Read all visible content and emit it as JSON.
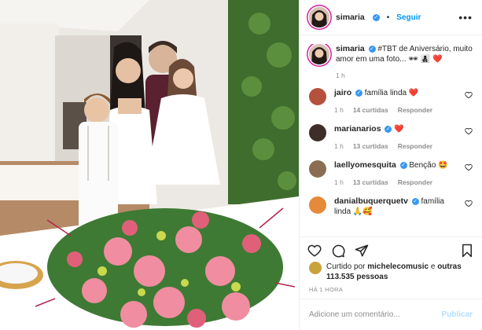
{
  "post": {
    "image_alt": "Foto de família ao redor de uma mesa com arranjo de flores"
  },
  "header": {
    "username": "simaria",
    "separator": "•",
    "follow_label": "Seguir",
    "more_icon": "more-icon"
  },
  "caption": {
    "username": "simaria",
    "text": "#TBT de Aniversário, muito amor em uma foto... 🕶 👩‍👧‍👦 ❤️",
    "time": "1 h"
  },
  "comments": [
    {
      "username": "jairo",
      "text": "família linda",
      "emoji": "❤️",
      "time": "1 h",
      "likes": "14 curtidas",
      "reply": "Responder",
      "avatar_color": "#b5503c"
    },
    {
      "username": "marianarios",
      "text": "",
      "emoji": "❤️",
      "time": "1 h",
      "likes": "13 curtidas",
      "reply": "Responder",
      "avatar_color": "#3d2e2a"
    },
    {
      "username": "laellyomesquita",
      "text": "Benção",
      "emoji": "🤩",
      "time": "1 h",
      "likes": "13 curtidas",
      "reply": "Responder",
      "avatar_color": "#8a6d52"
    },
    {
      "username": "danialbuquerquetv",
      "text": "família linda",
      "emoji": "🙏🥰",
      "time": "",
      "likes": "",
      "reply": "",
      "avatar_color": "#e48a3a"
    }
  ],
  "likes": {
    "prefix": "Curtido por",
    "user": "michelecomusic",
    "conj": "e",
    "others": "outras 113.535 pessoas"
  },
  "posted": "HÁ 1 HORA",
  "add_comment": {
    "placeholder": "Adicione um comentário...",
    "publish_label": "Publicar"
  },
  "colors": {
    "accent": "#0095f6",
    "verified": "#3897f0",
    "like_red": "#ed4956",
    "muted": "#8e8e8e"
  }
}
